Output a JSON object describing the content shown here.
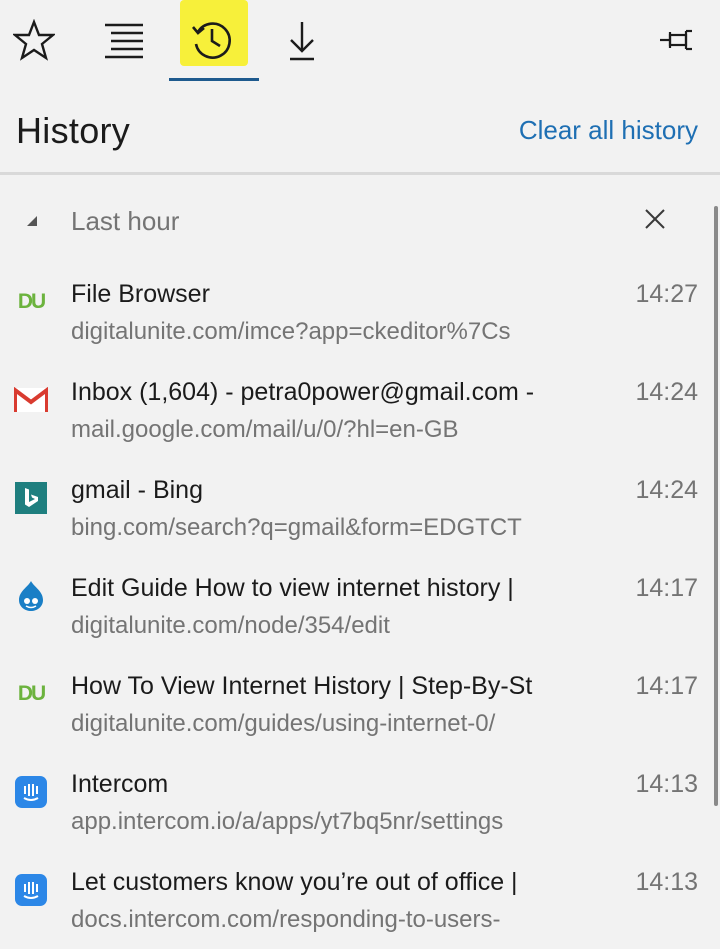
{
  "toolbar": {
    "favorites_icon": "star-icon",
    "reading_list_icon": "reading-list-icon",
    "history_icon": "history-clock-icon",
    "downloads_icon": "download-arrow-icon",
    "pin_icon": "pin-icon",
    "highlight_color": "#f7f03a",
    "active_underline_color": "#1e5a8e"
  },
  "header": {
    "title": "History",
    "clear_all": "Clear all history",
    "link_color": "#1e6fb3"
  },
  "group": {
    "label": "Last hour",
    "collapse_icon": "triangle-collapse-icon",
    "close_icon": "close-icon"
  },
  "items": [
    {
      "icon": "digitalunite-icon",
      "title": "File Browser",
      "url": "digitalunite.com/imce?app=ckeditor%7Cs",
      "time": "14:27"
    },
    {
      "icon": "gmail-icon",
      "title": "Inbox (1,604) - petra0power@gmail.com -",
      "url": "mail.google.com/mail/u/0/?hl=en-GB",
      "time": "14:24"
    },
    {
      "icon": "bing-icon",
      "title": "gmail - Bing",
      "url": "bing.com/search?q=gmail&form=EDGTCT",
      "time": "14:24"
    },
    {
      "icon": "drupal-icon",
      "title": "Edit Guide How to view internet history |",
      "url": "digitalunite.com/node/354/edit",
      "time": "14:17"
    },
    {
      "icon": "digitalunite-icon",
      "title": "How To View Internet History | Step-By-St",
      "url": "digitalunite.com/guides/using-internet-0/",
      "time": "14:17"
    },
    {
      "icon": "intercom-icon",
      "title": "Intercom",
      "url": "app.intercom.io/a/apps/yt7bq5nr/settings",
      "time": "14:13"
    },
    {
      "icon": "intercom-icon",
      "title": "Let customers know you’re out of office |",
      "url": "docs.intercom.com/responding-to-users-",
      "time": "14:13"
    }
  ]
}
